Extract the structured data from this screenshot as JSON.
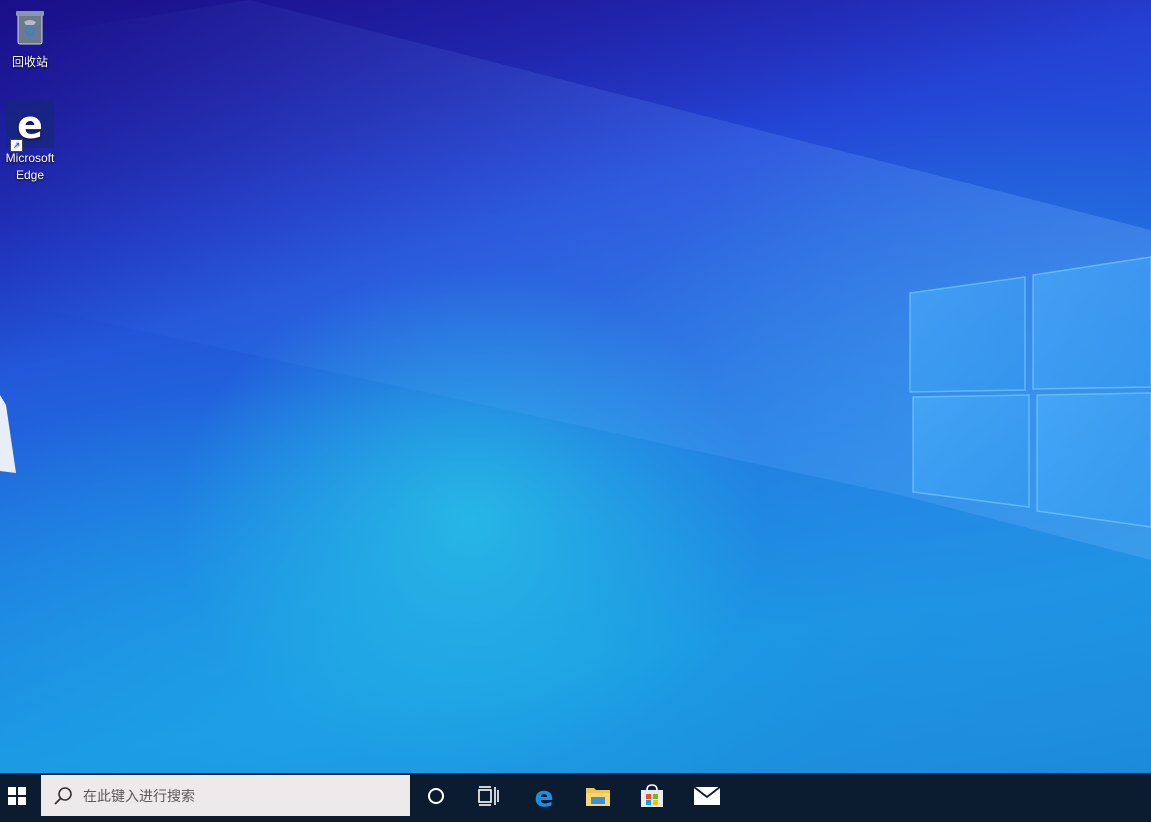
{
  "desktop": {
    "icons": [
      {
        "label": "回收站",
        "icon": "recycle-bin-icon"
      },
      {
        "label_line1": "Microsoft",
        "label_line2": "Edge",
        "icon": "edge-icon"
      }
    ]
  },
  "taskbar": {
    "search_placeholder": "在此键入进行搜索",
    "buttons": [
      {
        "icon": "windows-start-icon"
      },
      {
        "icon": "cortana-icon"
      },
      {
        "icon": "task-view-icon"
      },
      {
        "icon": "edge-icon"
      },
      {
        "icon": "file-explorer-icon"
      },
      {
        "icon": "store-icon"
      },
      {
        "icon": "mail-icon"
      }
    ]
  },
  "colors": {
    "taskbar": "#0b1c30",
    "search_box": "#eceaea",
    "edge_blue": "#1e8fe0"
  }
}
